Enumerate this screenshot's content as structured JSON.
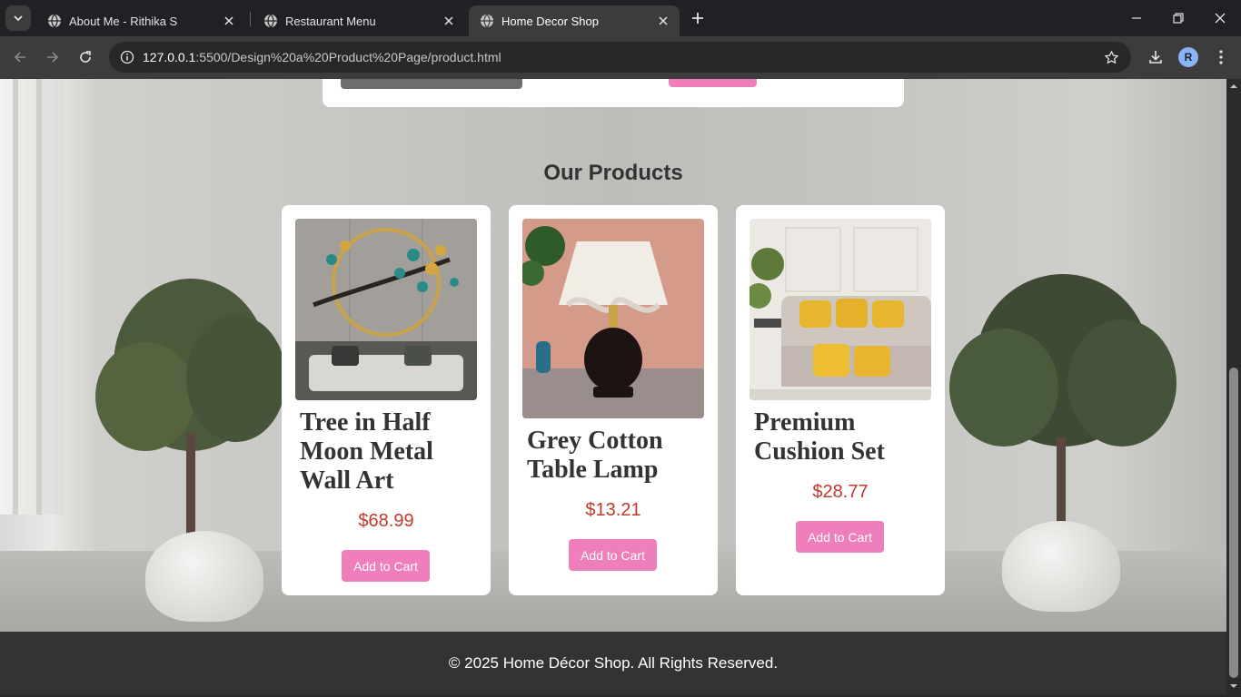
{
  "browser": {
    "tabs": [
      {
        "title": "About Me - Rithika S"
      },
      {
        "title": "Restaurant Menu"
      },
      {
        "title": "Home Decor Shop"
      }
    ],
    "url_host": "127.0.0.1",
    "url_path": ":5500/Design%20a%20Product%20Page/product.html",
    "profile_initial": "R"
  },
  "page": {
    "section_title": "Our Products",
    "products": [
      {
        "name": "Tree in Half Moon Metal Wall Art",
        "price": "$68.99",
        "button": "Add to Cart"
      },
      {
        "name": "Grey Cotton Table Lamp",
        "price": "$13.21",
        "button": "Add to Cart"
      },
      {
        "name": "Premium Cushion Set",
        "price": "$28.77",
        "button": "Add to Cart"
      }
    ],
    "footer": "© 2025 Home Décor Shop. All Rights Reserved."
  },
  "colors": {
    "accent_button": "#ee7fba",
    "price": "#c0392b",
    "footer_bg": "#333333"
  },
  "icons": [
    "tab-search-icon",
    "globe-icon",
    "close-icon",
    "plus-icon",
    "minimize-icon",
    "restore-icon",
    "window-close-icon",
    "back-icon",
    "forward-icon",
    "reload-icon",
    "info-icon",
    "star-icon",
    "download-icon",
    "menu-dots-icon"
  ]
}
